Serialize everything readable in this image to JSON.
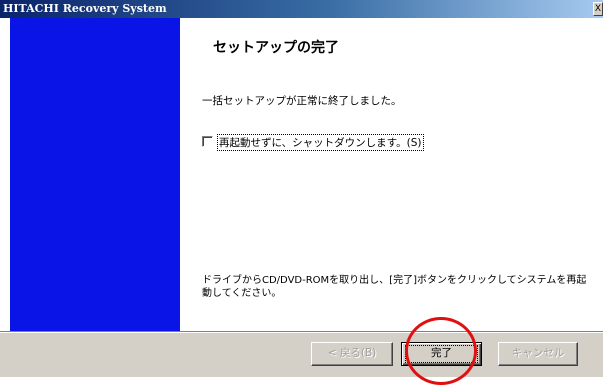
{
  "window": {
    "title": "HITACHI Recovery System",
    "close_glyph": "X"
  },
  "wizard": {
    "heading": "セットアップの完了",
    "message_completed": "一括セットアップが正常に終了しました。",
    "shutdown_checkbox": {
      "label": "再起動せずに、シャットダウンします。(S)",
      "checked": false
    },
    "message_instructions": "ドライブからCD/DVD-ROMを取り出し、[完了]ボタンをクリックしてシステムを再起動してください。"
  },
  "buttons": {
    "back": {
      "label": "< 戻る(B)",
      "enabled": false
    },
    "finish": {
      "label": "完了",
      "enabled": true
    },
    "cancel": {
      "label": "キャンセル",
      "enabled": false
    }
  },
  "colors": {
    "sidebar": "#0a14e6",
    "titlebar_start": "#0a246a",
    "highlight_circle": "#e01010"
  },
  "icons": {
    "close": "close-icon"
  }
}
